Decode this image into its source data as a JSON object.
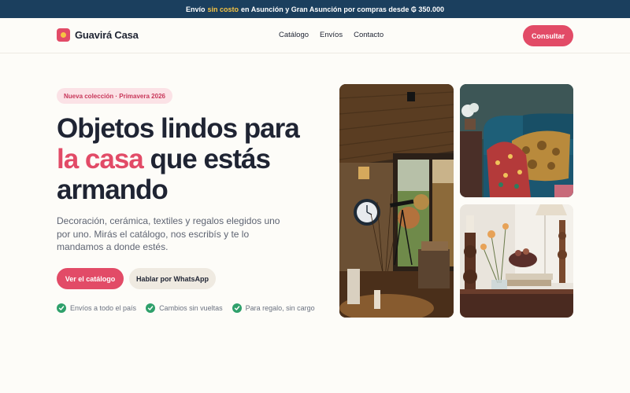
{
  "topbar": {
    "prefix": "Envío",
    "highlight": "sin costo",
    "suffix": "en Asunción y Gran Asunción por compras desde ₲ 350.000"
  },
  "nav": {
    "brand": "Guavirá Casa",
    "links": [
      "Catálogo",
      "Envíos",
      "Contacto"
    ],
    "cta": "Consultar"
  },
  "hero": {
    "badge": "Nueva colección · Primavera 2026",
    "headline_line1": "Objetos lindos para",
    "headline_accent": "la casa",
    "headline_line2_rest": "que estás",
    "headline_line3": "armando",
    "description": "Decoración, cerámica, textiles y regalos elegidos uno por uno. Mirás el catálogo, nos escribís y te lo mandamos a donde estés.",
    "primary_button": "Ver el catálogo",
    "secondary_button": "Hablar por WhatsApp",
    "features": [
      "Envíos a todo el país",
      "Cambios sin vueltas",
      "Para regalo, sin cargo"
    ]
  },
  "colors": {
    "accent": "#e24b67",
    "topbar": "#1b3f5e",
    "highlight": "#f6c343",
    "check": "#2fa06b",
    "background": "#fdfcf8"
  },
  "images": [
    "cozy-living-room-photo",
    "textile-armchair-photo",
    "decor-table-photo"
  ]
}
